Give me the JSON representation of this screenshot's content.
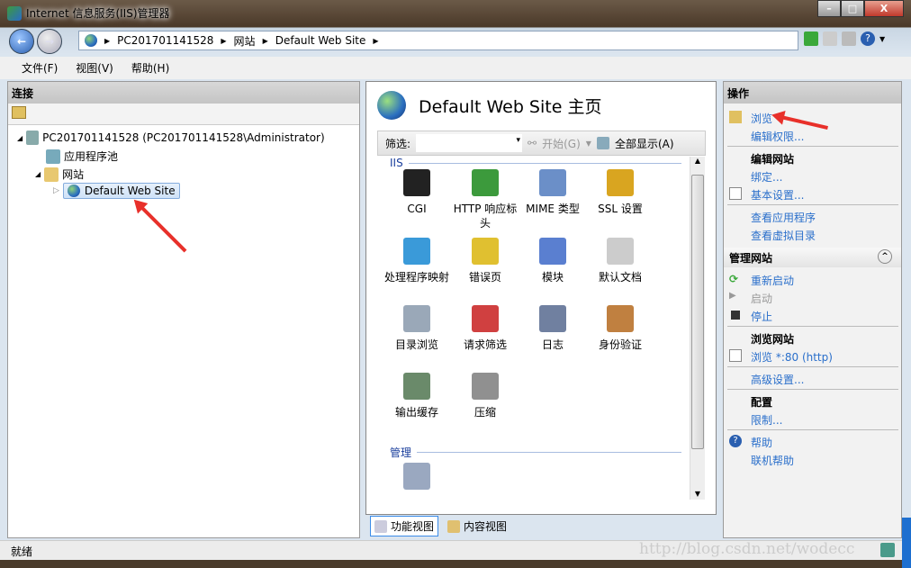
{
  "window": {
    "title": "Internet 信息服务(IIS)管理器",
    "min": "–",
    "max": "□",
    "close": "X"
  },
  "address": {
    "crumbs": [
      "PC201701141528",
      "网站",
      "Default Web Site"
    ]
  },
  "menu": [
    "文件(F)",
    "视图(V)",
    "帮助(H)"
  ],
  "connections": {
    "header": "连接",
    "tree": [
      {
        "label": "PC201701141528 (PC201701141528\\Administrator)",
        "expander": "◢"
      },
      {
        "label": "应用程序池"
      },
      {
        "label": "网站",
        "expander": "◢"
      },
      {
        "label": "Default Web Site",
        "expander": "▷",
        "selected": true
      }
    ]
  },
  "main": {
    "title": "Default Web Site 主页",
    "filter": {
      "label": "筛选:",
      "value": "",
      "go": "开始(G)",
      "show_all": "全部显示(A)"
    },
    "groups": [
      {
        "name": "IIS",
        "features": [
          {
            "label": "CGI",
            "icon": "cgi-icon",
            "color": "#222222"
          },
          {
            "label": "HTTP 响应标头",
            "icon": "http-headers-icon",
            "color": "#3c9a3c"
          },
          {
            "label": "MIME 类型",
            "icon": "mime-types-icon",
            "color": "#6b8fc8"
          },
          {
            "label": "SSL 设置",
            "icon": "lock-icon",
            "color": "#d9a520"
          },
          {
            "label": "处理程序映射",
            "icon": "handler-mappings-icon",
            "color": "#3a9ad9"
          },
          {
            "label": "错误页",
            "icon": "error-pages-icon",
            "color": "#e0c030"
          },
          {
            "label": "模块",
            "icon": "modules-icon",
            "color": "#5a7fd0"
          },
          {
            "label": "默认文档",
            "icon": "default-document-icon",
            "color": "#cccccc"
          },
          {
            "label": "目录浏览",
            "icon": "directory-browsing-icon",
            "color": "#9aa8b8"
          },
          {
            "label": "请求筛选",
            "icon": "request-filtering-icon",
            "color": "#d04040"
          },
          {
            "label": "日志",
            "icon": "logging-icon",
            "color": "#7080a0"
          },
          {
            "label": "身份验证",
            "icon": "authentication-icon",
            "color": "#c08040"
          },
          {
            "label": "输出缓存",
            "icon": "output-caching-icon",
            "color": "#6a8a6a"
          },
          {
            "label": "压缩",
            "icon": "compression-icon",
            "color": "#909090"
          }
        ]
      },
      {
        "name": "管理",
        "features": [
          {
            "label": "",
            "icon": "configuration-editor-icon",
            "color": "#9aa8c0"
          }
        ]
      }
    ]
  },
  "views": [
    "功能视图",
    "内容视图"
  ],
  "actions": {
    "header": "操作",
    "browse": "浏览",
    "edit_perms": "编辑权限...",
    "edit_site": "编辑网站",
    "bindings": "绑定...",
    "basic_settings": "基本设置...",
    "view_apps": "查看应用程序",
    "view_vdirs": "查看虚拟目录",
    "manage_site": "管理网站",
    "restart": "重新启动",
    "start": "启动",
    "stop": "停止",
    "browse_site": "浏览网站",
    "browse_80": "浏览 *:80 (http)",
    "advanced": "高级设置...",
    "config": "配置",
    "limits": "限制...",
    "help": "帮助",
    "online_help": "联机帮助"
  },
  "status": "就绪",
  "watermark": "http://blog.csdn.net/wodecc",
  "colors": {
    "link": "#2a6fcb",
    "annotation_arrow": "#e8302a"
  }
}
